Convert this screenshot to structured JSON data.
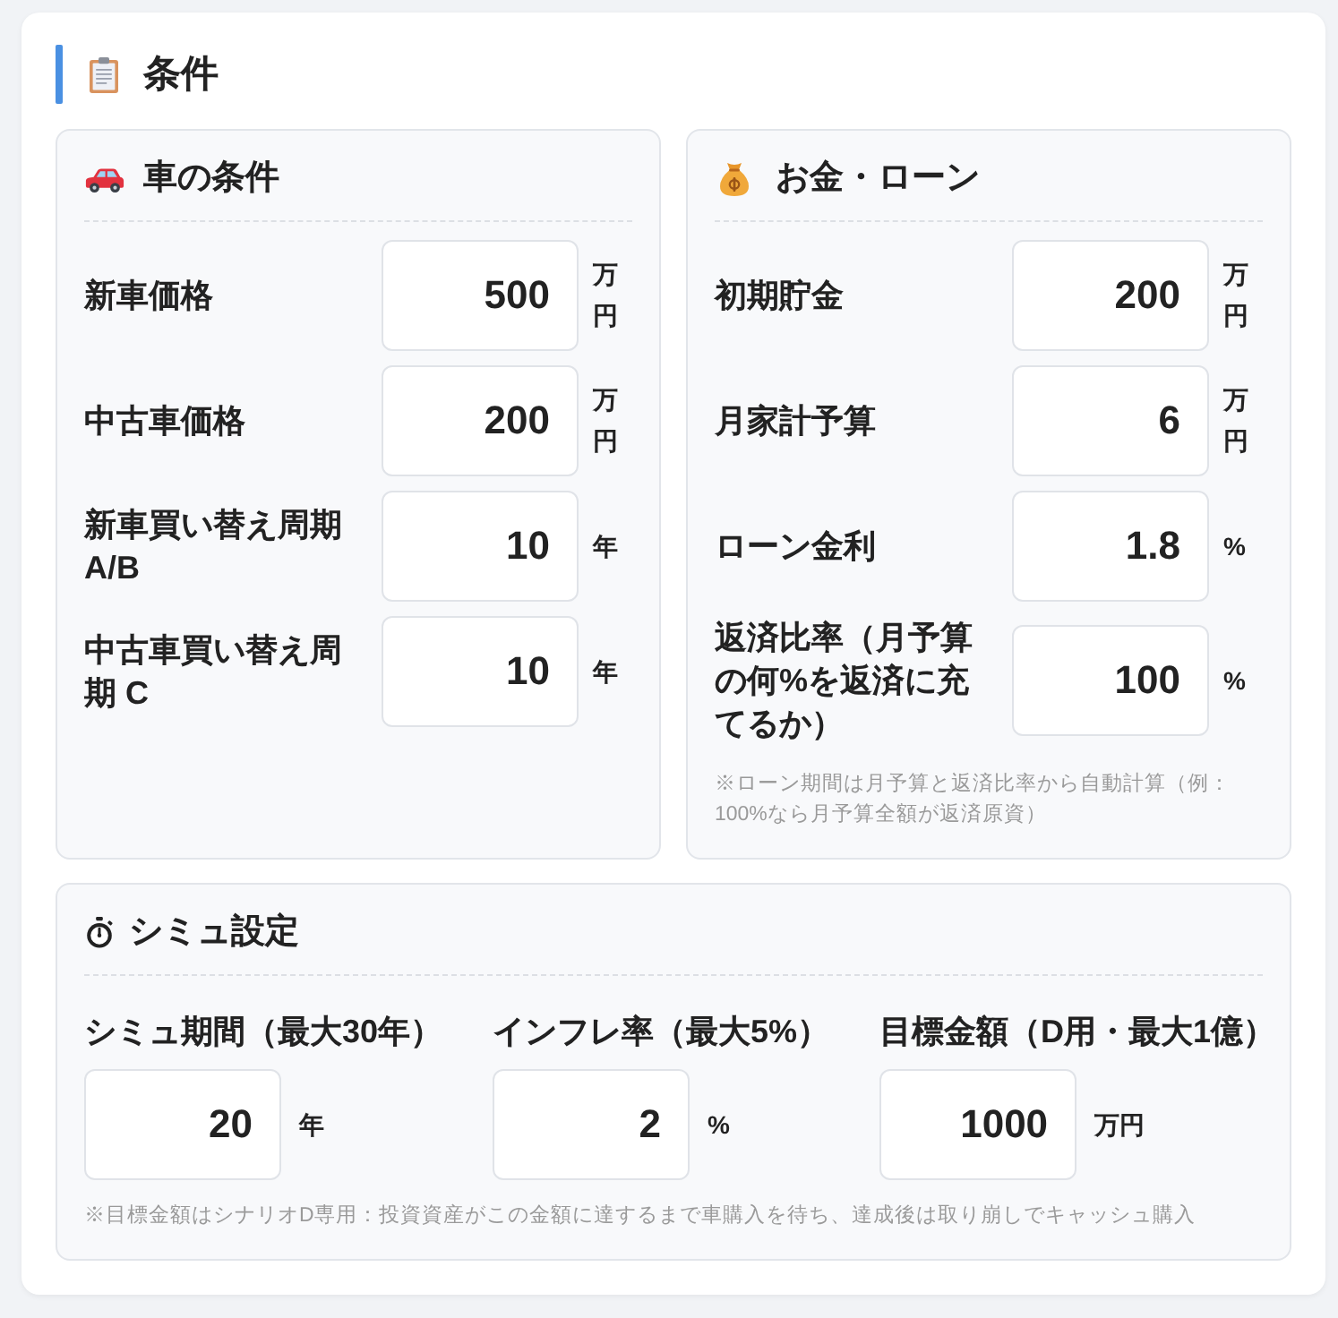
{
  "section": {
    "title": "条件"
  },
  "car_conditions": {
    "title": "車の条件",
    "fields": [
      {
        "label": "新車価格",
        "value": "500",
        "unit": "万円"
      },
      {
        "label": "中古車価格",
        "value": "200",
        "unit": "万円"
      },
      {
        "label": "新車買い替え周期 A/B",
        "value": "10",
        "unit": "年"
      },
      {
        "label": "中古車買い替え周期 C",
        "value": "10",
        "unit": "年"
      }
    ]
  },
  "money_loan": {
    "title": "お金・ローン",
    "fields": [
      {
        "label": "初期貯金",
        "value": "200",
        "unit": "万円"
      },
      {
        "label": "月家計予算",
        "value": "6",
        "unit": "万円"
      },
      {
        "label": "ローン金利",
        "value": "1.8",
        "unit": "%"
      },
      {
        "label": "返済比率（月予算の何%を返済に充てるか）",
        "value": "100",
        "unit": "%"
      }
    ],
    "note": "※ローン期間は月予算と返済比率から自動計算（例：100%なら月予算全額が返済原資）"
  },
  "simulation": {
    "title": "シミュ設定",
    "fields": [
      {
        "label": "シミュ期間（最大30年）",
        "value": "20",
        "unit": "年"
      },
      {
        "label": "インフレ率（最大5%）",
        "value": "2",
        "unit": "%"
      },
      {
        "label": "目標金額（D用・最大1億）",
        "value": "1000",
        "unit": "万円"
      }
    ],
    "note": "※目標金額はシナリオD専用：投資資産がこの金額に達するまで車購入を待ち、達成後は取り崩しでキャッシュ購入"
  }
}
